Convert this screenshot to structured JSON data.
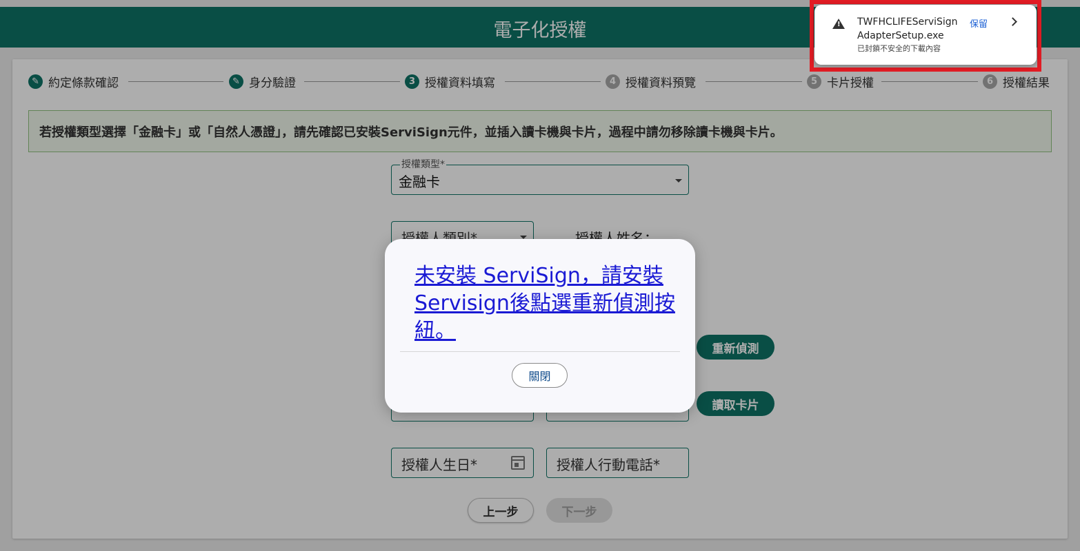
{
  "header": {
    "title": "電子化授權"
  },
  "stepper": [
    {
      "num": "✎",
      "label": "約定條款確認",
      "state": "done"
    },
    {
      "num": "✎",
      "label": "身分驗證",
      "state": "done"
    },
    {
      "num": "3",
      "label": "授權資料填寫",
      "state": "active"
    },
    {
      "num": "4",
      "label": "授權資料預覽",
      "state": "pending"
    },
    {
      "num": "5",
      "label": "卡片授權",
      "state": "pending"
    },
    {
      "num": "6",
      "label": "授權結果",
      "state": "pending"
    }
  ],
  "notice": "若授權類型選擇「金融卡」或「自然人憑證」，請先確認已安裝ServiSign元件，並插入讀卡機與卡片，過程中請勿移除讀卡機與卡片。",
  "form": {
    "auth_type_label": "授權類型*",
    "auth_type_value": "金融卡",
    "authorizer_category_label": "授權人類別*",
    "authorizer_name_label": "授權人姓名：",
    "redetect_label": "重新偵測",
    "read_card_label": "讀取卡片",
    "birthday_label": "授權人生日*",
    "mobile_label": "授權人行動電話*",
    "prev_label": "上一步",
    "next_label": "下一步"
  },
  "modal": {
    "message": "未安裝 ServiSign，請安裝Servisign後點選重新偵測按紐。",
    "close_label": "關閉"
  },
  "download": {
    "filename_line1": "TWFHCLIFEServiSign",
    "filename_line2": "AdapterSetup.exe",
    "warning": "已封鎖不安全的下載內容",
    "keep_label": "保留"
  }
}
